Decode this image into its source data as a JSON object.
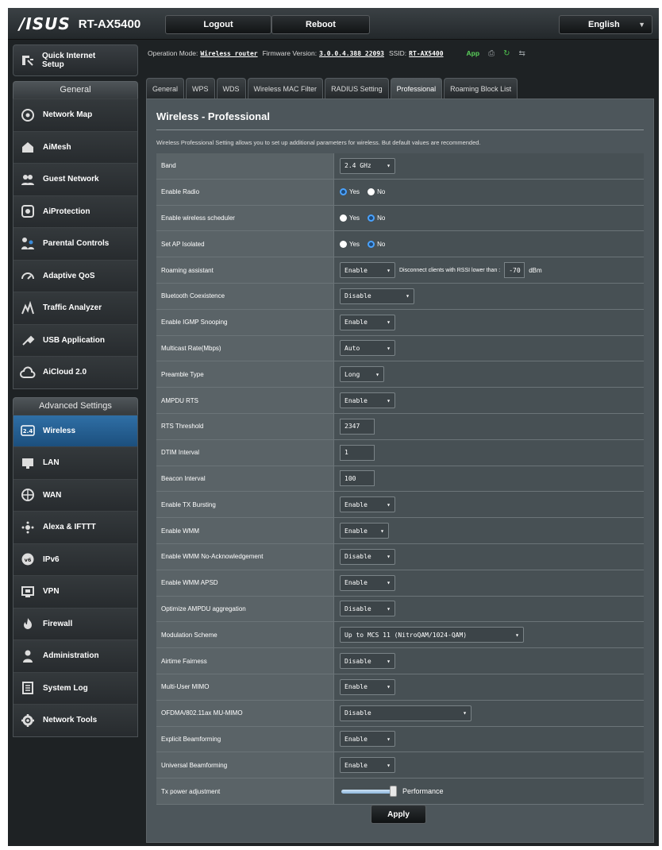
{
  "header": {
    "brand": "/ISUS",
    "model": "RT-AX5400",
    "logout_label": "Logout",
    "reboot_label": "Reboot",
    "language": "English"
  },
  "sidebar": {
    "quick_setup": "Quick Internet Setup",
    "general_heading": "General",
    "general_items": [
      {
        "label": "Network Map",
        "icon": "network-map-icon"
      },
      {
        "label": "AiMesh",
        "icon": "aimesh-icon"
      },
      {
        "label": "Guest Network",
        "icon": "guest-network-icon"
      },
      {
        "label": "AiProtection",
        "icon": "aiprotection-icon"
      },
      {
        "label": "Parental Controls",
        "icon": "parental-controls-icon"
      },
      {
        "label": "Adaptive QoS",
        "icon": "adaptive-qos-icon"
      },
      {
        "label": "Traffic Analyzer",
        "icon": "traffic-analyzer-icon"
      },
      {
        "label": "USB Application",
        "icon": "usb-application-icon"
      },
      {
        "label": "AiCloud 2.0",
        "icon": "aicloud-icon"
      }
    ],
    "advanced_heading": "Advanced Settings",
    "advanced_items": [
      {
        "label": "Wireless",
        "icon": "wireless-icon"
      },
      {
        "label": "LAN",
        "icon": "lan-icon"
      },
      {
        "label": "WAN",
        "icon": "wan-icon"
      },
      {
        "label": "Alexa & IFTTT",
        "icon": "alexa-icon"
      },
      {
        "label": "IPv6",
        "icon": "ipv6-icon"
      },
      {
        "label": "VPN",
        "icon": "vpn-icon"
      },
      {
        "label": "Firewall",
        "icon": "firewall-icon"
      },
      {
        "label": "Administration",
        "icon": "administration-icon"
      },
      {
        "label": "System Log",
        "icon": "system-log-icon"
      },
      {
        "label": "Network Tools",
        "icon": "network-tools-icon"
      }
    ]
  },
  "status_bar": {
    "op_mode_label": "Operation Mode:",
    "op_mode": "Wireless router",
    "firmware_label": "Firmware Version:",
    "firmware": "3.0.0.4.388_22093",
    "ssid_label": "SSID:",
    "ssid": "RT-AX5400",
    "app_label": "App"
  },
  "tabs": [
    "General",
    "WPS",
    "WDS",
    "Wireless MAC Filter",
    "RADIUS Setting",
    "Professional",
    "Roaming Block List"
  ],
  "panel": {
    "title": "Wireless - Professional",
    "description": "Wireless Professional Setting allows you to set up additional parameters for wireless. But default values are recommended."
  },
  "settings": {
    "band": {
      "label": "Band",
      "value": "2.4 GHz"
    },
    "enable_radio": {
      "label": "Enable Radio",
      "yes": "Yes",
      "no": "No"
    },
    "scheduler": {
      "label": "Enable wireless scheduler",
      "yes": "Yes",
      "no": "No"
    },
    "ap_isolated": {
      "label": "Set AP Isolated",
      "yes": "Yes",
      "no": "No"
    },
    "roaming": {
      "label": "Roaming assistant",
      "value": "Enable",
      "text": "Disconnect clients with RSSI lower than :",
      "rssi": "-70",
      "unit": "dBm"
    },
    "bluetooth": {
      "label": "Bluetooth Coexistence",
      "value": "Disable"
    },
    "igmp": {
      "label": "Enable IGMP Snooping",
      "value": "Enable"
    },
    "multicast": {
      "label": "Multicast Rate(Mbps)",
      "value": "Auto"
    },
    "preamble": {
      "label": "Preamble Type",
      "value": "Long"
    },
    "ampdu_rts": {
      "label": "AMPDU RTS",
      "value": "Enable"
    },
    "rts_threshold": {
      "label": "RTS Threshold",
      "value": "2347"
    },
    "dtim": {
      "label": "DTIM Interval",
      "value": "1"
    },
    "beacon": {
      "label": "Beacon Interval",
      "value": "100"
    },
    "tx_bursting": {
      "label": "Enable TX Bursting",
      "value": "Enable"
    },
    "wmm": {
      "label": "Enable WMM",
      "value": "Enable"
    },
    "wmm_noack": {
      "label": "Enable WMM No-Acknowledgement",
      "value": "Disable"
    },
    "wmm_apsd": {
      "label": "Enable WMM APSD",
      "value": "Enable"
    },
    "ampdu_agg": {
      "label": "Optimize AMPDU aggregation",
      "value": "Disable"
    },
    "modulation": {
      "label": "Modulation Scheme",
      "value": "Up to MCS 11 (NitroQAM/1024-QAM)"
    },
    "airtime": {
      "label": "Airtime Fairness",
      "value": "Disable"
    },
    "mu_mimo": {
      "label": "Multi-User MIMO",
      "value": "Enable"
    },
    "ofdma": {
      "label": "OFDMA/802.11ax MU-MIMO",
      "value": "Disable"
    },
    "explicit_bf": {
      "label": "Explicit Beamforming",
      "value": "Enable"
    },
    "universal_bf": {
      "label": "Universal Beamforming",
      "value": "Enable"
    },
    "tx_power": {
      "label": "Tx power adjustment",
      "value_text": "Performance",
      "level": 1.0
    }
  },
  "apply_label": "Apply",
  "colors": {
    "accent": "#2f6fa6",
    "panel": "#4d565b",
    "frame": "#1e2224"
  }
}
